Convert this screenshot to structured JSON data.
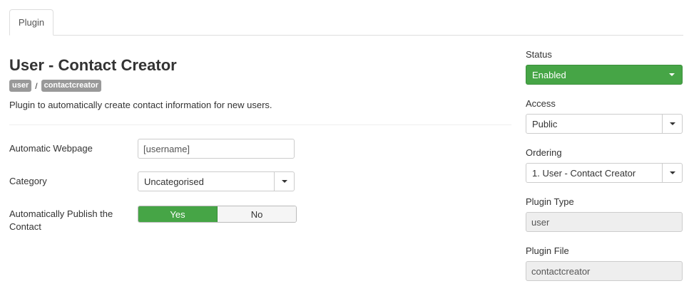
{
  "tabs": [
    {
      "label": "Plugin"
    }
  ],
  "plugin": {
    "title": "User - Contact Creator",
    "badges": [
      "user",
      "contactcreator"
    ],
    "separator": "/",
    "description": "Plugin to automatically create contact information for new users."
  },
  "fields": {
    "webpage": {
      "label": "Automatic Webpage",
      "value": "[username]"
    },
    "category": {
      "label": "Category",
      "value": "Uncategorised"
    },
    "autopublish": {
      "label_line1": "Automatically Publish the",
      "label_line2": "Contact",
      "options": [
        "Yes",
        "No"
      ],
      "selected": "Yes"
    }
  },
  "sidebar": {
    "status": {
      "label": "Status",
      "value": "Enabled"
    },
    "access": {
      "label": "Access",
      "value": "Public"
    },
    "ordering": {
      "label": "Ordering",
      "value": "1. User - Contact Creator"
    },
    "plugin_type": {
      "label": "Plugin Type",
      "value": "user"
    },
    "plugin_file": {
      "label": "Plugin File",
      "value": "contactcreator"
    }
  },
  "colors": {
    "success": "#46a546",
    "badge": "#999999",
    "readonly_bg": "#eeeeee"
  },
  "icons": [
    "dropdown-caret-icon"
  ]
}
